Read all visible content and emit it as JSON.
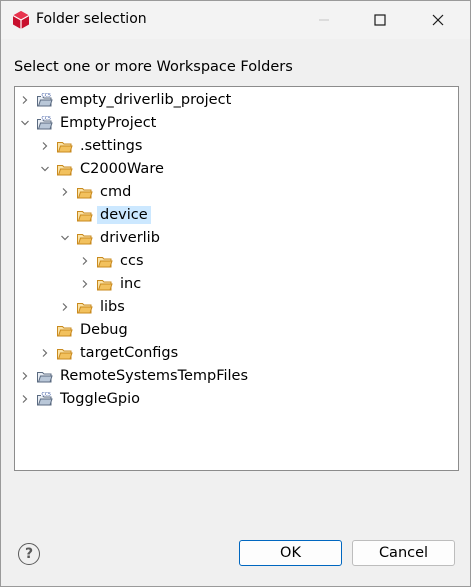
{
  "window": {
    "title": "Folder selection",
    "icon": "app-icon"
  },
  "dialog": {
    "prompt": "Select one or more Workspace Folders",
    "ok_label": "OK",
    "cancel_label": "Cancel",
    "help_label": "?"
  },
  "tree": [
    {
      "label": "empty_driverlib_project",
      "depth": 0,
      "chevron": "collapsed",
      "icon": "ccs-project-icon"
    },
    {
      "label": "EmptyProject",
      "depth": 0,
      "chevron": "expanded",
      "icon": "ccs-project-icon"
    },
    {
      "label": ".settings",
      "depth": 1,
      "chevron": "collapsed",
      "icon": "folder-icon"
    },
    {
      "label": "C2000Ware",
      "depth": 1,
      "chevron": "expanded",
      "icon": "folder-icon"
    },
    {
      "label": "cmd",
      "depth": 2,
      "chevron": "collapsed",
      "icon": "folder-icon"
    },
    {
      "label": "device",
      "depth": 2,
      "chevron": "none",
      "icon": "folder-icon",
      "selected": true
    },
    {
      "label": "driverlib",
      "depth": 2,
      "chevron": "expanded",
      "icon": "folder-icon"
    },
    {
      "label": "ccs",
      "depth": 3,
      "chevron": "collapsed",
      "icon": "folder-icon"
    },
    {
      "label": "inc",
      "depth": 3,
      "chevron": "collapsed",
      "icon": "folder-icon"
    },
    {
      "label": "libs",
      "depth": 2,
      "chevron": "collapsed",
      "icon": "folder-icon"
    },
    {
      "label": "Debug",
      "depth": 1,
      "chevron": "none",
      "icon": "folder-icon"
    },
    {
      "label": "targetConfigs",
      "depth": 1,
      "chevron": "collapsed",
      "icon": "folder-icon"
    },
    {
      "label": "RemoteSystemsTempFiles",
      "depth": 0,
      "chevron": "collapsed",
      "icon": "project-icon"
    },
    {
      "label": "ToggleGpio",
      "depth": 0,
      "chevron": "collapsed",
      "icon": "ccs-project-icon"
    }
  ],
  "colors": {
    "selection": "#cce8ff",
    "folder": "#e7a93c",
    "default_button_border": "#0067c0"
  }
}
